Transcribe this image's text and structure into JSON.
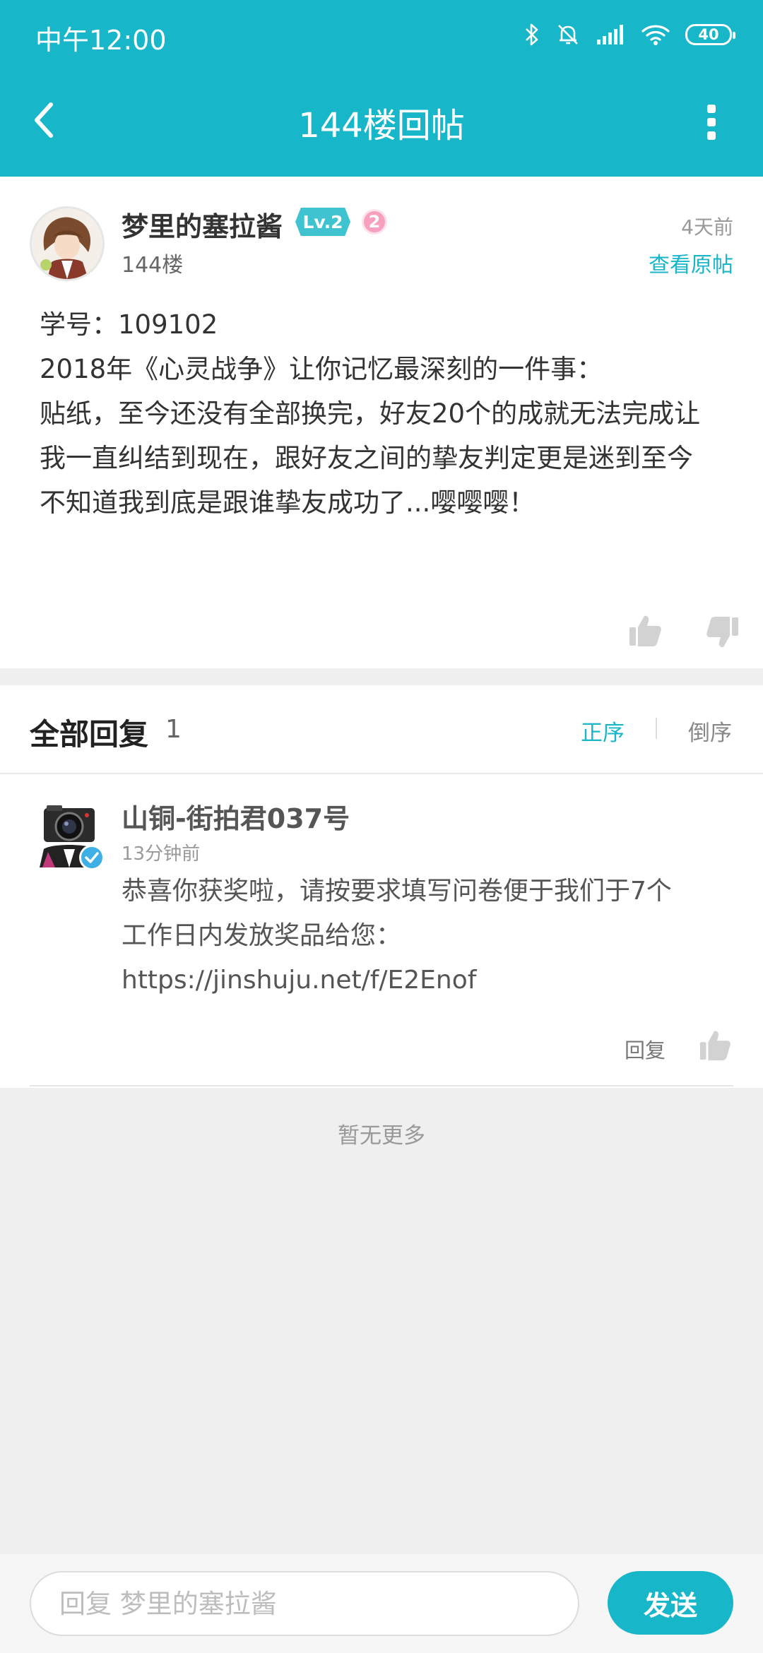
{
  "status_bar": {
    "time": "中午12:00",
    "battery": "40",
    "icons": [
      "bluetooth-icon",
      "muted-bell-icon",
      "signal-icon",
      "wifi-icon",
      "battery-icon"
    ]
  },
  "header": {
    "title": "144楼回帖",
    "back_icon": "chevron-left-icon",
    "more_icon": "more-vertical-icon",
    "background": "#17b6c9"
  },
  "post": {
    "author": "梦里的塞拉酱",
    "level": "Lv.2",
    "rank": "2",
    "floor": "144楼",
    "time": "4天前",
    "view_original": "查看原帖",
    "body_lines": [
      "学号：109102",
      "2018年《心灵战争》让你记忆最深刻的一件事：",
      "贴纸，至今还没有全部换完，好友20个的成就无法完成让",
      "我一直纠结到现在，跟好友之间的挚友判定更是迷到至今",
      "不知道我到底是跟谁挚友成功了...嘤嘤嘤！"
    ]
  },
  "replies": {
    "title": "全部回复",
    "count": "1",
    "sort_asc": "正序",
    "sort_desc": "倒序",
    "items": [
      {
        "author": "山铜-街拍君037号",
        "time": "13分钟前",
        "body_lines": [
          "恭喜你获奖啦，请按要求填写问卷便于我们于7个",
          "工作日内发放奖品给您：",
          "https://jinshuju.net/f/E2Enof"
        ],
        "reply_label": "回复"
      }
    ],
    "no_more": "暂无更多"
  },
  "bottom_bar": {
    "placeholder": "回复 梦里的塞拉酱",
    "send_label": "发送"
  },
  "colors": {
    "accent": "#17b6c9",
    "level_badge": "#3fc3d0",
    "rank_badge": "#f7a0c0"
  }
}
